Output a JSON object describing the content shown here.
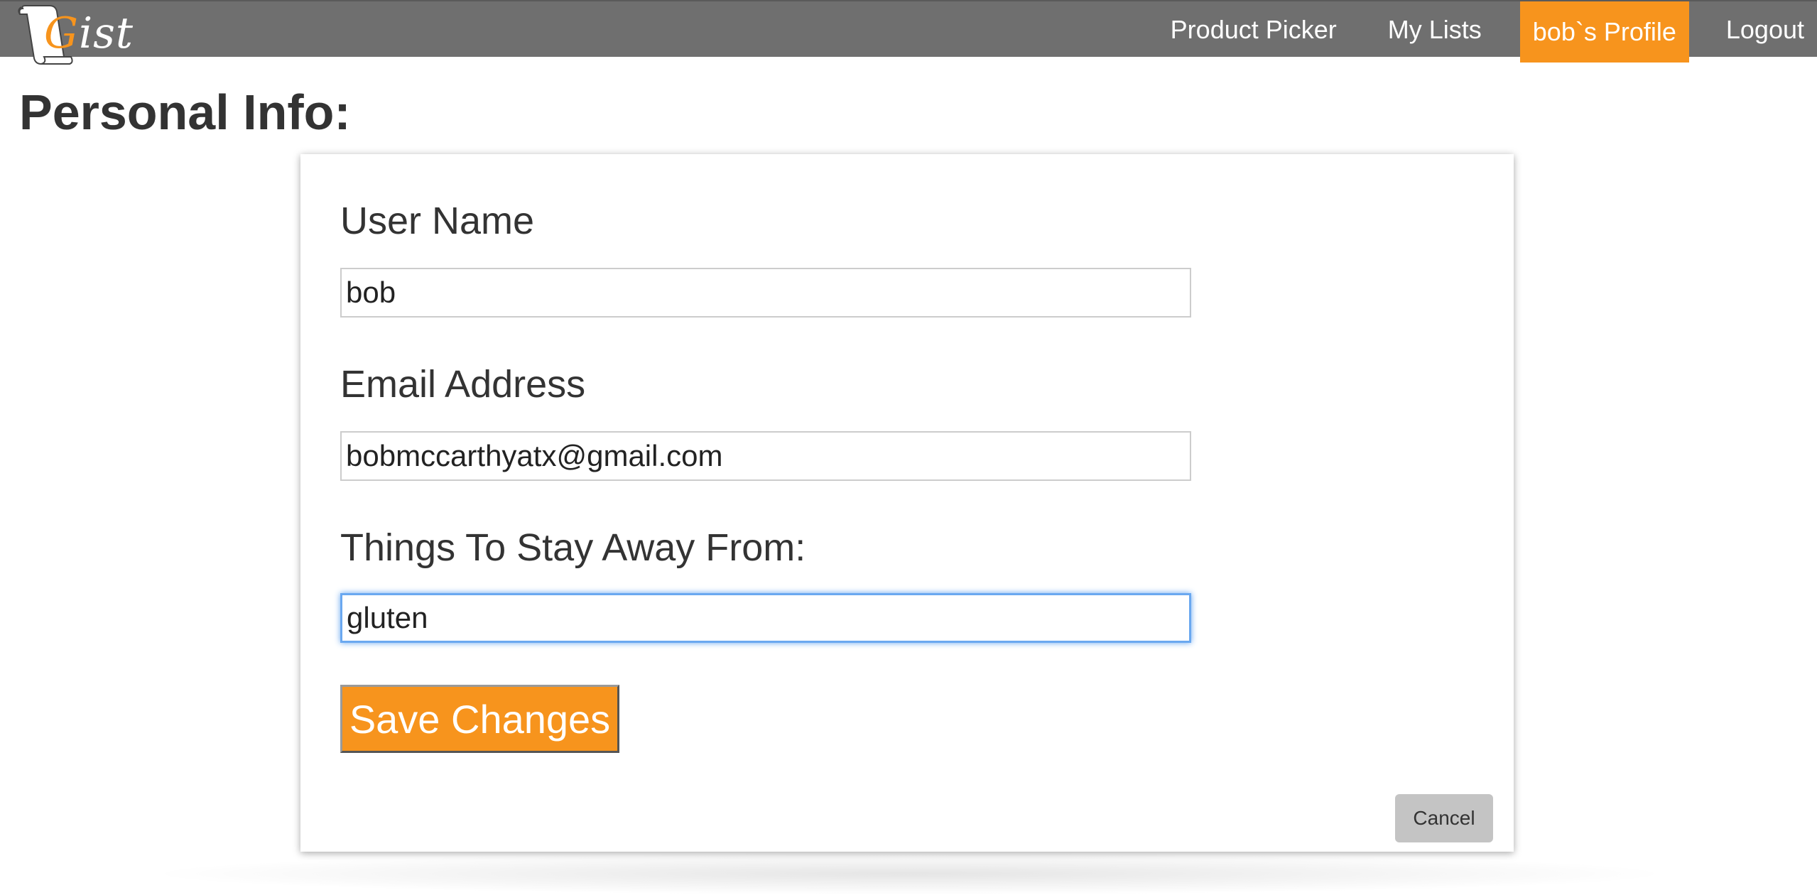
{
  "navbar": {
    "logo_text_first": "G",
    "logo_text_rest": "ist",
    "items": [
      {
        "label": "Product Picker"
      },
      {
        "label": "My Lists"
      },
      {
        "label": "bob`s Profile"
      },
      {
        "label": "Logout"
      }
    ],
    "active_index": 2
  },
  "page": {
    "title": "Personal Info:"
  },
  "form": {
    "username": {
      "label": "User Name",
      "value": "bob"
    },
    "email": {
      "label": "Email Address",
      "value": "bobmccarthyatx@gmail.com"
    },
    "avoid": {
      "label": "Things To Stay Away From:",
      "value": "gluten"
    },
    "save_label": "Save Changes",
    "cancel_label": "Cancel"
  },
  "colors": {
    "accent": "#f7941d",
    "navbar": "#6f6f6f",
    "focus_ring": "#6aa8f0"
  }
}
